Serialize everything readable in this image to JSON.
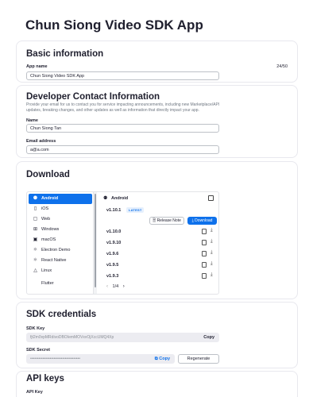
{
  "app": {
    "title": "Chun Siong Video SDK App"
  },
  "basic": {
    "title": "Basic information",
    "app_name_label": "App name",
    "app_name_counter": "24/50",
    "app_name_value": "Chun Siong Video SDK App"
  },
  "contact": {
    "title": "Developer Contact Information",
    "description": "Provide your email for us to contact you for service impacting announcements, including new Marketplace/API updates, breaking changes, and other updates as well as information that directly impact your app.",
    "name_label": "Name",
    "name_value": "Chun Siong Tan",
    "email_label": "Email address",
    "email_value": "a@a.com"
  },
  "download": {
    "title": "Download",
    "platforms": [
      {
        "label": "Android",
        "icon": "android-icon",
        "active": true
      },
      {
        "label": "iOS",
        "icon": "phone-icon"
      },
      {
        "label": "Web",
        "icon": "browser-icon"
      },
      {
        "label": "Windows",
        "icon": "windows-icon"
      },
      {
        "label": "macOS",
        "icon": "apple-icon"
      },
      {
        "label": "Electron Demo",
        "icon": "electron-icon"
      },
      {
        "label": "React Native",
        "icon": "react-icon"
      },
      {
        "label": "Linux",
        "icon": "linux-icon"
      },
      {
        "label": "Flutter",
        "icon": "flutter-icon"
      }
    ],
    "selected_platform": "Android",
    "latest_version": "v1.10.1",
    "latest_badge": "LATEST",
    "release_note_label": "Release Note",
    "download_label": "Download",
    "versions": [
      "v1.10.0",
      "v1.9.10",
      "v1.9.6",
      "v1.9.5",
      "v1.9.3"
    ],
    "pager": "1/4"
  },
  "sdk_credentials": {
    "title": "SDK credentials",
    "key_label": "SDK Key",
    "key_value": "fjt2m0vpMRdivoDBOIemMOVxvOjXccUMQ4Xp",
    "key_copy": "Copy",
    "secret_label": "SDK Secret",
    "secret_value": "••••••••••••••••••••••••••••••••••••",
    "secret_copy": "Copy",
    "regenerate_label": "Regenerate"
  },
  "api_keys": {
    "title": "API keys",
    "key_label": "API Key"
  },
  "colors": {
    "accent": "#0e71eb",
    "text": "#232333",
    "muted": "#6e7680",
    "field_bg": "#ececf1"
  }
}
